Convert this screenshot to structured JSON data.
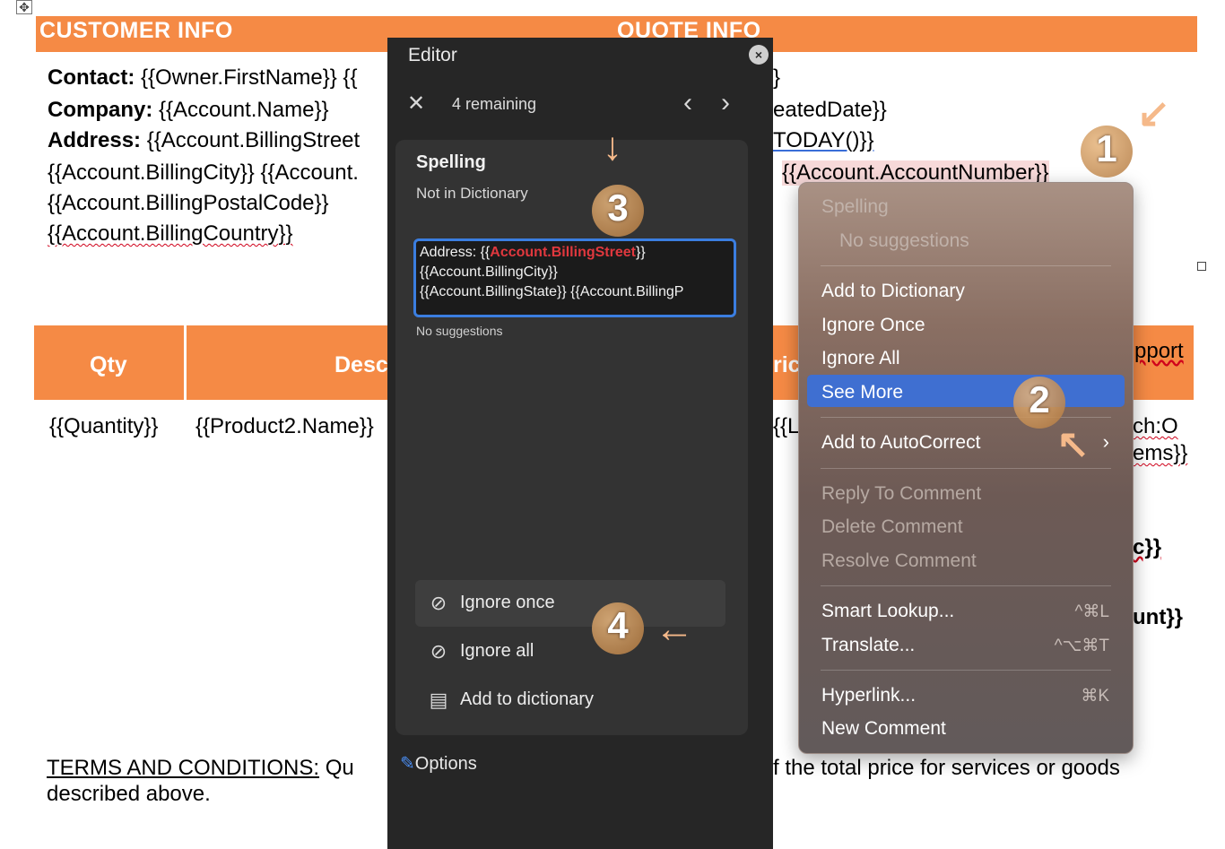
{
  "document": {
    "move_handle": "✥",
    "customer_info_header": "CUSTOMER INFO",
    "quote_info_header": "QUOTE INFO",
    "contact_label": "Contact:",
    "contact_value": "{{Owner.FirstName}} {{",
    "company_label": "Company:",
    "company_value": "{{Account.Name}}",
    "address_label": "Address:",
    "address_value": "{{Account.BillingStreet",
    "billing_city": "{{Account.BillingCity}} {{Account.",
    "billing_postal": "{{Account.BillingPostalCode}}",
    "billing_country": "{{Account.BillingCountry}}",
    "right_line1": "}",
    "right_line2": "eatedDate}}",
    "right_line3": "TODAY()}}",
    "account_number": "{{Account.AccountNumber}}",
    "table": {
      "qty_header": "Qty",
      "desc_header": "Desc",
      "price_header": "ric",
      "support_header": "pport",
      "quantity_cell": "{{Quantity}}",
      "product_cell": "{{Product2.Name}}",
      "list_cell": "{{L",
      "support_cell1": "ch:O",
      "support_cell2": "ems}}",
      "cell3": "c}}",
      "cell4": "unt}}"
    },
    "terms_label": "TERMS AND CONDITIONS:",
    "terms_text_left": " Qu",
    "terms_text_right": "f the total price for services or goods",
    "terms_line2": "described above."
  },
  "editor": {
    "title": "Editor",
    "close_icon": "×",
    "dismiss_icon": "✕",
    "remaining": "4 remaining",
    "prev_icon": "‹",
    "next_icon": "›",
    "category": "Spelling",
    "subcategory": "Not in Dictionary",
    "snippet_prefix": "Address: {{",
    "snippet_error": "Account.BillingStreet",
    "snippet_suffix": "}}",
    "snippet_line2": "{{Account.BillingCity}}",
    "snippet_line3": "{{Account.BillingState}} {{Account.BillingP",
    "no_suggestions": "No suggestions",
    "actions": [
      {
        "label": "Ignore once",
        "icon": "⊘"
      },
      {
        "label": "Ignore all",
        "icon": "⊘"
      },
      {
        "label": "Add to dictionary",
        "icon": "▤"
      }
    ],
    "options_label": "Options",
    "options_icon": "✎"
  },
  "context_menu": {
    "spelling_header": "Spelling",
    "no_suggestions": "No suggestions",
    "items": {
      "add_to_dictionary": "Add to Dictionary",
      "ignore_once": "Ignore Once",
      "ignore_all": "Ignore All",
      "see_more": "See More",
      "add_to_autocorrect": "Add to AutoCorrect",
      "reply_to_comment": "Reply To Comment",
      "delete_comment": "Delete Comment",
      "resolve_comment": "Resolve Comment",
      "smart_lookup": "Smart Lookup...",
      "translate": "Translate...",
      "hyperlink": "Hyperlink...",
      "new_comment": "New Comment"
    },
    "shortcuts": {
      "smart_lookup": "^⌘L",
      "translate": "^⌥⌘T",
      "hyperlink": "⌘K"
    },
    "submenu_icon": "›"
  },
  "annotations": {
    "badge1": "1",
    "badge2": "2",
    "badge3": "3",
    "badge4": "4",
    "arrow1": "↙",
    "arrow2": "↖",
    "arrow3": "↓",
    "arrow4": "←",
    "accent_color": "#f5b98a"
  }
}
